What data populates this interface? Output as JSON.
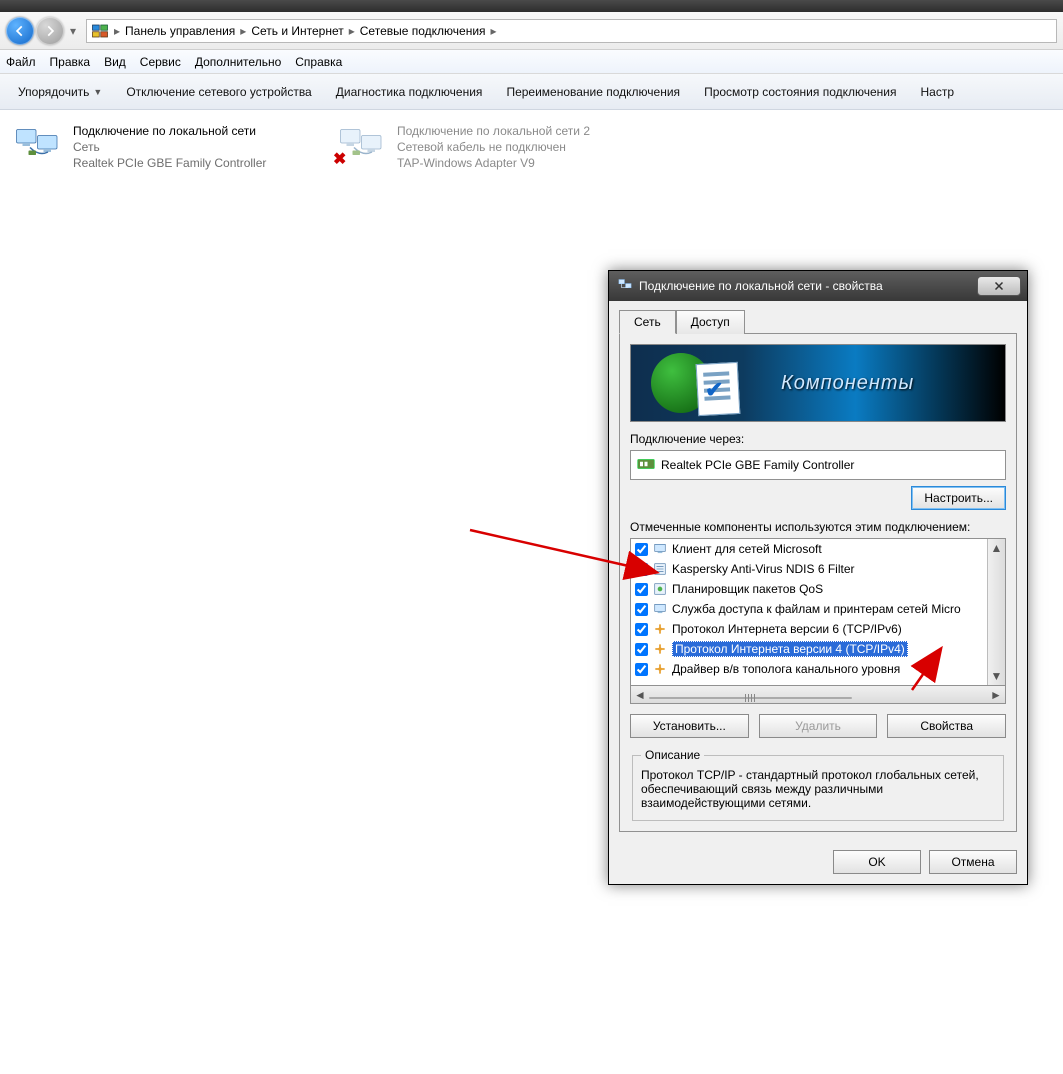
{
  "breadcrumb": {
    "items": [
      "Панель управления",
      "Сеть и Интернет",
      "Сетевые подключения"
    ]
  },
  "menu": {
    "items": [
      "Файл",
      "Правка",
      "Вид",
      "Сервис",
      "Дополнительно",
      "Справка"
    ]
  },
  "toolbar": {
    "items": [
      "Упорядочить",
      "Отключение сетевого устройства",
      "Диагностика подключения",
      "Переименование подключения",
      "Просмотр состояния подключения",
      "Настр"
    ]
  },
  "adapters": {
    "a1": {
      "name": "Подключение по локальной сети",
      "status": "Сеть",
      "device": "Realtek PCIe GBE Family Controller"
    },
    "a2": {
      "name": "Подключение по локальной сети 2",
      "status": "Сетевой кабель не подключен",
      "device": "TAP-Windows Adapter V9"
    }
  },
  "dialog": {
    "title": "Подключение по локальной сети - свойства",
    "tabs": {
      "net": "Сеть",
      "access": "Доступ"
    },
    "banner": "Компоненты",
    "connect_via_label": "Подключение через:",
    "device": "Realtek PCIe GBE Family Controller",
    "configure_btn": "Настроить...",
    "components_label": "Отмеченные компоненты используются этим подключением:",
    "components": [
      {
        "checked": true,
        "label": "Клиент для сетей Microsoft"
      },
      {
        "checked": true,
        "label": "Kaspersky Anti-Virus NDIS 6 Filter"
      },
      {
        "checked": true,
        "label": "Планировщик пакетов QoS"
      },
      {
        "checked": true,
        "label": "Служба доступа к файлам и принтерам сетей Micro"
      },
      {
        "checked": true,
        "label": "Протокол Интернета версии 6 (TCP/IPv6)"
      },
      {
        "checked": true,
        "label": "Протокол Интернета версии 4 (TCP/IPv4)",
        "selected": true
      },
      {
        "checked": true,
        "label": "Драйвер в/в тополога канального уровня"
      }
    ],
    "install_btn": "Установить...",
    "remove_btn": "Удалить",
    "properties_btn": "Свойства",
    "desc_legend": "Описание",
    "desc_text": "Протокол TCP/IP - стандартный протокол глобальных сетей, обеспечивающий связь между различными взаимодействующими сетями.",
    "ok": "OK",
    "cancel": "Отмена"
  }
}
